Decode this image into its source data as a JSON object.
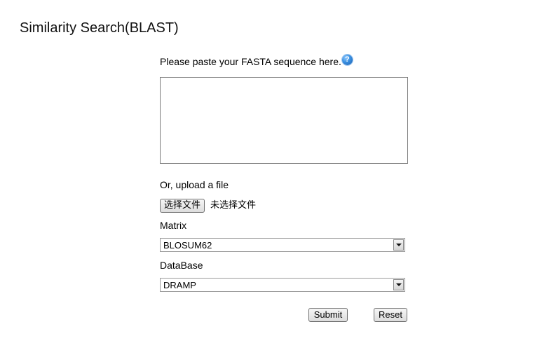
{
  "page": {
    "title": "Similarity Search(BLAST)"
  },
  "sequence": {
    "prompt": "Please paste your FASTA sequence here.",
    "help_icon": "question-mark-icon",
    "help_glyph": "?",
    "value": ""
  },
  "upload": {
    "label": "Or, upload a file",
    "button_label": "选择文件",
    "status": "未选择文件"
  },
  "matrix": {
    "label": "Matrix",
    "selected": "BLOSUM62"
  },
  "database": {
    "label": "DataBase",
    "selected": "DRAMP"
  },
  "actions": {
    "submit_label": "Submit",
    "reset_label": "Reset"
  },
  "colors": {
    "help_icon": "#3a8fe0",
    "border": "#7a7a7a"
  }
}
